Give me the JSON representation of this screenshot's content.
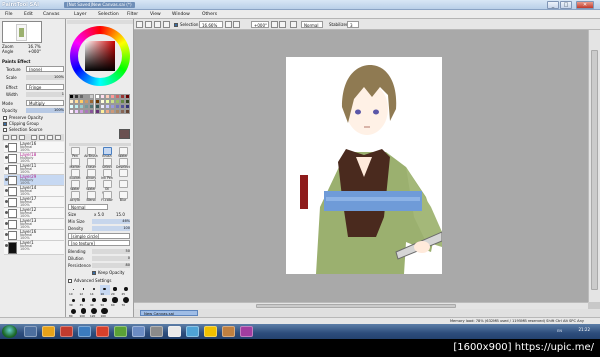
{
  "window": {
    "app_logo": "PaintTool SAI",
    "title": "[Not Saved]New Canvas.sai (*)",
    "min": "_",
    "max": "□",
    "close": "✕"
  },
  "menu": [
    "File",
    "Edit",
    "Canvas",
    "Layer",
    "Selection",
    "Filter",
    "View",
    "Window",
    "Others"
  ],
  "toolbar": {
    "selection_label": "Selection",
    "zoom": "16.66%",
    "angle": "+000°",
    "mode": "Normal",
    "stabilizer_label": "Stabilizer",
    "stabilizer_value": "3"
  },
  "navigator": {
    "zoom_label": "Zoom",
    "zoom_value": "16.7%",
    "angle_label": "Angle",
    "angle_value": "+000°"
  },
  "paper_effect": {
    "header": "Paints Effect",
    "texture_label": "Texture",
    "texture_value": "(none)",
    "scale_label": "Scale",
    "scale_value": "100%",
    "effect_label": "Effect",
    "effect_value": "Fringe",
    "width_label": "Width",
    "width_value": "1"
  },
  "layer_props": {
    "mode_label": "Mode",
    "mode_value": "Multiply",
    "opacity_label": "Opacity",
    "opacity_value": "100%",
    "preserve": "Preserve Opacity",
    "clipping": "Clipping Group",
    "selection_source": "Selection Source"
  },
  "layers": [
    {
      "name": "Layer16",
      "mode": "Normal",
      "opacity": "100%",
      "pink": false,
      "selected": false
    },
    {
      "name": "Layer18",
      "mode": "Multiply",
      "opacity": "100%",
      "pink": true,
      "selected": false
    },
    {
      "name": "Layer11",
      "mode": "Normal",
      "opacity": "100%",
      "pink": false,
      "selected": false
    },
    {
      "name": "Layer29",
      "mode": "Multiply",
      "opacity": "100%",
      "pink": true,
      "selected": true
    },
    {
      "name": "Layer14",
      "mode": "Normal",
      "opacity": "100%",
      "pink": false,
      "selected": false
    },
    {
      "name": "Layer17",
      "mode": "Normal",
      "opacity": "100%",
      "pink": false,
      "selected": false
    },
    {
      "name": "Layer12",
      "mode": "Normal",
      "opacity": "100%",
      "pink": false,
      "selected": false
    },
    {
      "name": "Layer13",
      "mode": "Normal",
      "opacity": "100%",
      "pink": false,
      "selected": false
    },
    {
      "name": "Layer16",
      "mode": "Normal",
      "opacity": "100%",
      "pink": false,
      "selected": false
    },
    {
      "name": "Layer1",
      "mode": "Normal",
      "opacity": "100%",
      "pink": false,
      "selected": false
    }
  ],
  "tools": [
    "Pen",
    "AirBrush",
    "Brush",
    "Water",
    "Marker",
    "Eraser",
    "Select",
    "Deselect",
    "Bucket",
    "Binary",
    "Ink Pen",
    "",
    "Water",
    "Water",
    "Oil Water",
    "",
    "Acrylic",
    "Blend",
    "Fl.color",
    "Blur"
  ],
  "brush": {
    "mode": "Normal",
    "size_label": "Size",
    "size_mult": "x 5.0",
    "size_value": "15.0",
    "minsize_label": "Min Size",
    "minsize_value": "46%",
    "density_label": "Density",
    "density_value": "100",
    "shape": "[simple circle]",
    "texture": "[no texture]",
    "blending_label": "Blending",
    "blending_value": "50",
    "dilution_label": "Dilution",
    "dilution_value": "0",
    "persistence_label": "Persistence",
    "persistence_value": "80",
    "keep_opacity": "Keep Opacity",
    "advanced": "Advanced Settings"
  },
  "brush_sizes": [
    "10",
    "12",
    "14",
    "16",
    "20",
    "25",
    "30",
    "35",
    "40",
    "50",
    "60",
    "70",
    "80",
    "100",
    "120",
    "160",
    "200",
    "250",
    "300",
    "350",
    "400",
    "500"
  ],
  "doc_tab": {
    "name": "New Canvas.sai",
    "zoom": "16%"
  },
  "status": "Memory load: 78% (632MB used / 1195MB reserved)   Shift Ctrl Alt SPC  Any",
  "taskbar": {
    "tray": "EN",
    "clock": "21:22"
  },
  "credit": "[1600x900] https://upic.me/",
  "colors": {
    "accent": "#3a6ea5",
    "canvas_bg": "#a9a9a9",
    "robe": "#9bb06f",
    "sash": "#6f9bd8",
    "vest": "#4a2a1e"
  }
}
